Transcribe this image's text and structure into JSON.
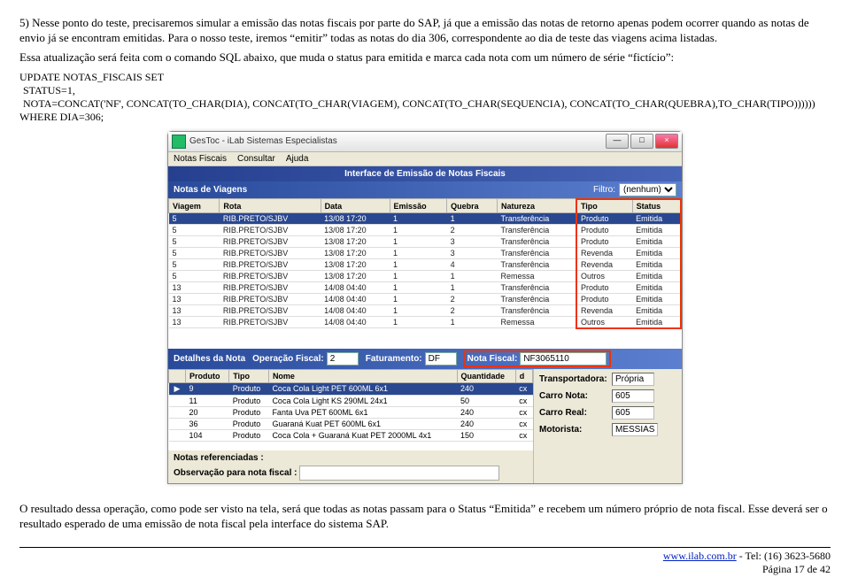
{
  "text": {
    "par1": "5) Nesse ponto do teste, precisaremos simular a emissão das notas fiscais por parte do SAP, já que a emissão das notas de retorno apenas podem ocorrer quando as notas de envio já se encontram emitidas. Para o nosso teste, iremos “emitir” todas as notas do dia 306, correspondente ao dia de teste das viagens acima listadas.",
    "par2": "Essa atualização será feita com o comando SQL abaixo, que muda o status para emitida e marca cada nota com um número de série “fictício”:",
    "sql1": "UPDATE NOTAS_FISCAIS SET",
    "sql2": "STATUS=1,",
    "sql3": "NOTA=CONCAT('NF', CONCAT(TO_CHAR(DIA), CONCAT(TO_CHAR(VIAGEM), CONCAT(TO_CHAR(SEQUENCIA), CONCAT(TO_CHAR(QUEBRA),TO_CHAR(TIPO))))))",
    "sql4": "WHERE DIA=306;",
    "par3": "O resultado dessa operação, como pode ser visto na tela, será que todas as notas passam para o Status “Emitida” e recebem um número próprio de nota fiscal. Esse deverá ser o resultado esperado de uma emissão de nota fiscal pela interface do sistema SAP."
  },
  "win": {
    "title": "GesToc - iLab Sistemas Especialistas",
    "menu": [
      "Notas Fiscais",
      "Consultar",
      "Ajuda"
    ],
    "header": "Interface de Emissão de Notas Fiscais",
    "sectionNotas": "Notas de Viagens",
    "filterLabel": "Filtro:",
    "filterValue": "(nenhum)",
    "cols1": [
      "Viagem",
      "Rota",
      "Data",
      "Emissão",
      "Quebra",
      "Natureza",
      "Tipo",
      "Status"
    ],
    "rows1": [
      [
        "5",
        "RIB.PRETO/SJBV",
        "13/08 17:20",
        "1",
        "1",
        "Transferência",
        "Produto",
        "Emitida"
      ],
      [
        "5",
        "RIB.PRETO/SJBV",
        "13/08 17:20",
        "1",
        "2",
        "Transferência",
        "Produto",
        "Emitida"
      ],
      [
        "5",
        "RIB.PRETO/SJBV",
        "13/08 17:20",
        "1",
        "3",
        "Transferência",
        "Produto",
        "Emitida"
      ],
      [
        "5",
        "RIB.PRETO/SJBV",
        "13/08 17:20",
        "1",
        "3",
        "Transferência",
        "Revenda",
        "Emitida"
      ],
      [
        "5",
        "RIB.PRETO/SJBV",
        "13/08 17:20",
        "1",
        "4",
        "Transferência",
        "Revenda",
        "Emitida"
      ],
      [
        "5",
        "RIB.PRETO/SJBV",
        "13/08 17:20",
        "1",
        "1",
        "Remessa",
        "Outros",
        "Emitida"
      ],
      [
        "13",
        "RIB.PRETO/SJBV",
        "14/08 04:40",
        "1",
        "1",
        "Transferência",
        "Produto",
        "Emitida"
      ],
      [
        "13",
        "RIB.PRETO/SJBV",
        "14/08 04:40",
        "1",
        "2",
        "Transferência",
        "Produto",
        "Emitida"
      ],
      [
        "13",
        "RIB.PRETO/SJBV",
        "14/08 04:40",
        "1",
        "2",
        "Transferência",
        "Revenda",
        "Emitida"
      ],
      [
        "13",
        "RIB.PRETO/SJBV",
        "14/08 04:40",
        "1",
        "1",
        "Remessa",
        "Outros",
        "Emitida"
      ]
    ],
    "panel": {
      "detalhes": "Detalhes da Nota",
      "opFiscalLabel": "Operação Fiscal:",
      "opFiscalValue": "2",
      "fatLabel": "Faturamento:",
      "fatValue": "DF",
      "nfLabel": "Nota Fiscal:",
      "nfValue": "NF3065110"
    },
    "cols2": [
      "",
      "Produto",
      "Tipo",
      "Nome",
      "Quantidade",
      "d"
    ],
    "rows2": [
      [
        "▶",
        "9",
        "Produto",
        "Coca Cola Light PET 600ML 6x1",
        "240",
        "cx"
      ],
      [
        "",
        "11",
        "Produto",
        "Coca Cola Light KS 290ML 24x1",
        "50",
        "cx"
      ],
      [
        "",
        "20",
        "Produto",
        "Fanta Uva PET 600ML 6x1",
        "240",
        "cx"
      ],
      [
        "",
        "36",
        "Produto",
        "Guaraná Kuat PET 600ML 6x1",
        "240",
        "cx"
      ],
      [
        "",
        "104",
        "Produto",
        "Coca Cola + Guaraná Kuat PET 2000ML 4x1",
        "150",
        "cx"
      ]
    ],
    "side": {
      "transpLabel": "Transportadora:",
      "transpValue": "Própria",
      "carroNotaLabel": "Carro Nota:",
      "carroNotaValue": "605",
      "carroRealLabel": "Carro Real:",
      "carroRealValue": "605",
      "motorLabel": "Motorista:",
      "motorValue": "MESSIAS"
    },
    "obs": {
      "notasRefLabel": "Notas referenciadas :",
      "obsLabel": "Observação para nota fiscal :"
    }
  },
  "footer": {
    "link": "www.ilab.com.br",
    "tel": " - Tel: (16) 3623-5680",
    "page": "Página 17 de 42"
  }
}
